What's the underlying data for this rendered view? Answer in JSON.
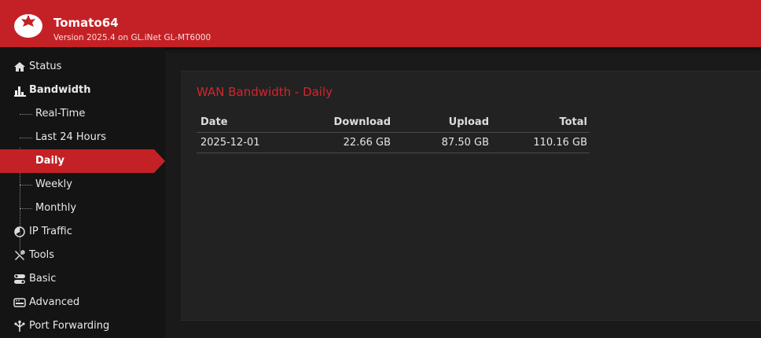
{
  "app": {
    "title": "Tomato64",
    "version": "Version 2025.4 on GL.iNet GL-MT6000"
  },
  "sidebar": {
    "items": [
      {
        "label": "Status",
        "icon": "home-icon"
      },
      {
        "label": "Bandwidth",
        "icon": "bar-chart-icon"
      },
      {
        "label": "IP Traffic",
        "icon": "pie-chart-icon"
      },
      {
        "label": "Tools",
        "icon": "tools-icon"
      },
      {
        "label": "Basic",
        "icon": "toggle-icon"
      },
      {
        "label": "Advanced",
        "icon": "router-icon"
      },
      {
        "label": "Port Forwarding",
        "icon": "network-icon"
      }
    ],
    "bandwidth_sub": [
      {
        "label": "Real-Time"
      },
      {
        "label": "Last 24 Hours"
      },
      {
        "label": "Daily"
      },
      {
        "label": "Weekly"
      },
      {
        "label": "Monthly"
      }
    ],
    "active": "Daily"
  },
  "main": {
    "title": "WAN Bandwidth - Daily",
    "table": {
      "headers": [
        "Date",
        "Download",
        "Upload",
        "Total"
      ],
      "rows": [
        [
          "2025-12-01",
          "22.66 GB",
          "87.50 GB",
          "110.16 GB"
        ]
      ]
    }
  },
  "colors": {
    "brand_red": "#c42126",
    "title_red": "#d2262c",
    "background": "#1a1a1a",
    "panel": "#222222"
  }
}
